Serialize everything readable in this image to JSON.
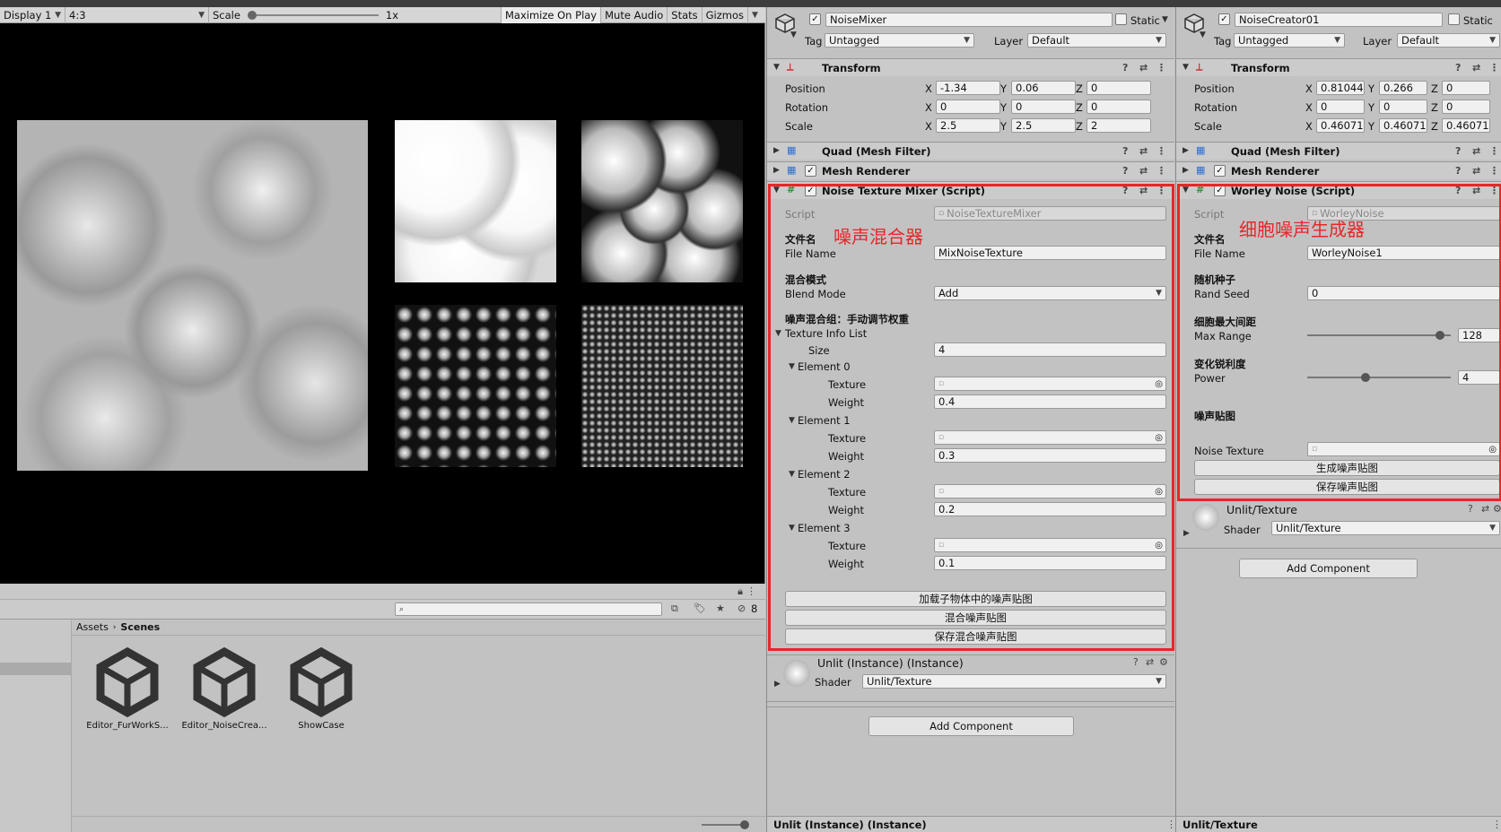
{
  "game": {
    "display": "Display 1",
    "aspect": "4:3",
    "scale_label": "Scale",
    "scale_value": "1x",
    "buttons": [
      "Maximize On Play",
      "Mute Audio",
      "Stats",
      "Gizmos"
    ]
  },
  "project": {
    "search_placeholder": "",
    "hidden_count": "8",
    "breadcrumb": [
      "Assets",
      "Scenes"
    ],
    "assets": [
      "Editor_FurWorkS...",
      "Editor_NoiseCrea...",
      "ShowCase"
    ]
  },
  "mixer": {
    "name": "NoiseMixer",
    "static": "Static",
    "tag_label": "Tag",
    "tag": "Untagged",
    "layer_label": "Layer",
    "layer": "Default",
    "transform": {
      "title": "Transform",
      "position_label": "Position",
      "rotation_label": "Rotation",
      "scale_label": "Scale",
      "position": [
        "-1.34",
        "0.06",
        "0"
      ],
      "rotation": [
        "0",
        "0",
        "0"
      ],
      "scale": [
        "2.5",
        "2.5",
        "2"
      ]
    },
    "mesh_filter": "Quad (Mesh Filter)",
    "mesh_renderer": "Mesh Renderer",
    "script_title": "Noise Texture Mixer (Script)",
    "script_label": "Script",
    "script_value": "NoiseTextureMixer",
    "annotation": "噪声混合器",
    "filename_header": "文件名",
    "filename_label": "File Name",
    "filename": "MixNoiseTexture",
    "blend_header": "混合模式",
    "blend_label": "Blend Mode",
    "blend": "Add",
    "group_header": "噪声混合组：手动调节权重",
    "list_label": "Texture Info List",
    "size_label": "Size",
    "size": "4",
    "elements": [
      {
        "label": "Element 0",
        "texture_label": "Texture",
        "weight_label": "Weight",
        "weight": "0.4"
      },
      {
        "label": "Element 1",
        "texture_label": "Texture",
        "weight_label": "Weight",
        "weight": "0.3"
      },
      {
        "label": "Element 2",
        "texture_label": "Texture",
        "weight_label": "Weight",
        "weight": "0.2"
      },
      {
        "label": "Element 3",
        "texture_label": "Texture",
        "weight_label": "Weight",
        "weight": "0.1"
      }
    ],
    "buttons": [
      "加载子物体中的噪声贴图",
      "混合噪声贴图",
      "保存混合噪声贴图"
    ],
    "material": "Unlit (Instance) (Instance)",
    "shader_label": "Shader",
    "shader": "Unlit/Texture",
    "add_component": "Add Component",
    "footer": "Unlit (Instance) (Instance)"
  },
  "creator": {
    "name": "NoiseCreator01",
    "static": "Static",
    "tag_label": "Tag",
    "tag": "Untagged",
    "layer_label": "Layer",
    "layer": "Default",
    "transform": {
      "title": "Transform",
      "position_label": "Position",
      "rotation_label": "Rotation",
      "scale_label": "Scale",
      "position": [
        "0.81044",
        "0.266",
        "0"
      ],
      "rotation": [
        "0",
        "0",
        "0"
      ],
      "scale": [
        "0.460711",
        "0.460711",
        "0.460711"
      ]
    },
    "mesh_filter": "Quad (Mesh Filter)",
    "mesh_renderer": "Mesh Renderer",
    "script_title": "Worley Noise (Script)",
    "script_label": "Script",
    "script_value": "WorleyNoise",
    "annotation": "细胞噪声生成器",
    "filename_header": "文件名",
    "filename_label": "File Name",
    "filename": "WorleyNoise1",
    "seed_header": "随机种子",
    "seed_label": "Rand Seed",
    "seed": "0",
    "range_header": "细胞最大间距",
    "range_label": "Max Range",
    "range": "128",
    "range_fraction": 0.95,
    "power_header": "变化锐利度",
    "power_label": "Power",
    "power": "4",
    "power_fraction": 0.4,
    "tex_header": "噪声贴图",
    "tex_label": "Noise Texture",
    "buttons": [
      "生成噪声贴图",
      "保存噪声贴图"
    ],
    "material": "Unlit/Texture",
    "shader_label": "Shader",
    "shader": "Unlit/Texture",
    "add_component": "Add Component",
    "footer": "Unlit/Texture"
  },
  "axis": [
    "X",
    "Y",
    "Z"
  ]
}
